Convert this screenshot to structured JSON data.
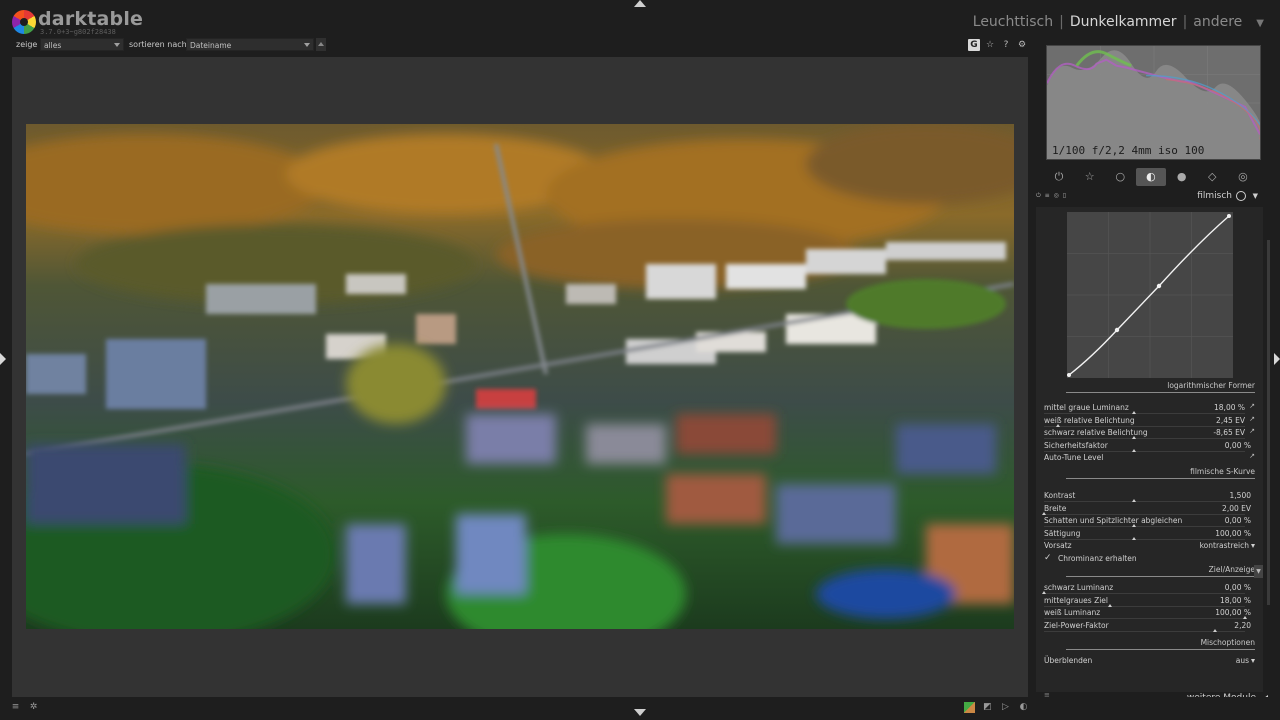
{
  "app": {
    "name": "darktable",
    "version": "3.7.0+3~g802f28438"
  },
  "views": {
    "lighttable": "Leuchttisch",
    "separator": "|",
    "darkroom": "Dunkelkammer",
    "other": "andere"
  },
  "filter": {
    "show_label": "zeige",
    "show_value": "alles",
    "sort_label": "sortieren nach",
    "sort_value": "Dateiname"
  },
  "top_icons": {
    "grouping": "G",
    "star": "☆",
    "help": "?",
    "prefs": "⚙"
  },
  "histogram": {
    "exif": "1/100 f/2,2 4mm iso 100"
  },
  "module_groups": [
    {
      "name": "active-modules-group-icon",
      "glyph": "⏻"
    },
    {
      "name": "base-group-icon",
      "glyph": "☆"
    },
    {
      "name": "tone-group-icon",
      "glyph": "○"
    },
    {
      "name": "color-group-icon",
      "glyph": "◐"
    },
    {
      "name": "correct-group-icon",
      "glyph": "●"
    },
    {
      "name": "effect-group-icon",
      "glyph": "◇"
    },
    {
      "name": "presets-group-icon",
      "glyph": "◎"
    }
  ],
  "module": {
    "name": "filmisch",
    "sections": {
      "log_shaper": "logarithmischer Former",
      "s_curve": "filmische S-Kurve",
      "target": "Ziel/Anzeige",
      "blend_options": "Mischoptionen"
    },
    "log_params": [
      {
        "label": "mittel graue Luminanz",
        "value": "18,00 %",
        "pos": 0.45
      },
      {
        "label": "weiß relative Belichtung",
        "value": "2,45 EV",
        "pos": 0.07
      },
      {
        "label": "schwarz relative Belichtung",
        "value": "-8,65 EV",
        "pos": 0.45
      },
      {
        "label": "Sicherheitsfaktor",
        "value": "0,00 %",
        "pos": 0.45
      }
    ],
    "auto_tune": "Auto-Tune Level",
    "curve_params": [
      {
        "label": "Kontrast",
        "value": "1,500",
        "pos": 0.45
      },
      {
        "label": "Breite",
        "value": "2,00 EV",
        "pos": 0.0
      },
      {
        "label": "Schatten und Spitzlichter abgleichen",
        "value": "0,00 %",
        "pos": 0.45
      },
      {
        "label": "Sättigung",
        "value": "100,00 %",
        "pos": 0.45
      }
    ],
    "preset_label": "Vorsatz",
    "preset_value": "kontrastreich",
    "preserve_chroma": "Chrominanz erhalten",
    "target_params": [
      {
        "label": "schwarz Luminanz",
        "value": "0,00 %",
        "pos": 0.0
      },
      {
        "label": "mittelgraues Ziel",
        "value": "18,00 %",
        "pos": 0.33
      },
      {
        "label": "weiß Luminanz",
        "value": "100,00 %",
        "pos": 1.0
      },
      {
        "label": "Ziel-Power-Faktor",
        "value": "2,20",
        "pos": 0.85
      }
    ],
    "blend_label": "Überblenden",
    "blend_value": "aus"
  },
  "more_modules": "weitere Module",
  "colors": {
    "accent_active_group": "#555555",
    "panel_bg": "#1e1e1e",
    "center_bg": "#333333"
  }
}
